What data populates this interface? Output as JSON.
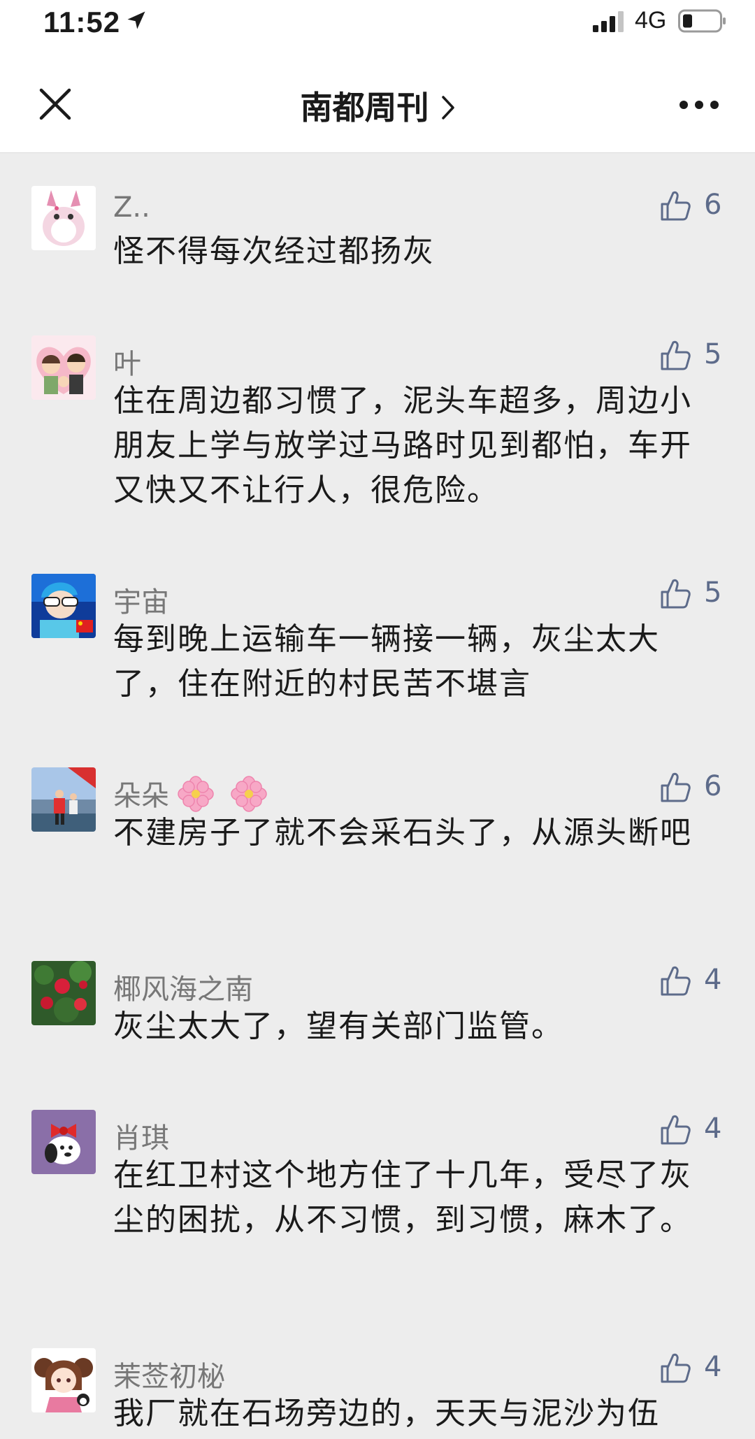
{
  "status": {
    "time": "11:52",
    "network": "4G"
  },
  "nav": {
    "title": "南都周刊"
  },
  "icons": {
    "close": "close-icon",
    "more": "more-icon",
    "like": "thumbs-up-icon"
  },
  "colors": {
    "background": "#ededed",
    "name": "#777777",
    "like": "#5d6b8a"
  },
  "comments": [
    {
      "name": "Z..",
      "likes": "6",
      "text": "怪不得每次经过都扬灰"
    },
    {
      "name": "叶",
      "likes": "5",
      "text": "住在周边都习惯了，泥头车超多，周边小朋友上学与放学过马路时见到都怕，车开又快又不让行人，很危险。"
    },
    {
      "name": "宇宙",
      "likes": "5",
      "text": "每到晚上运输车一辆接一辆，灰尘太大了，住在附近的村民苦不堪言"
    },
    {
      "name": "朵朵",
      "likes": "6",
      "text": "不建房子了就不会采石头了，从源头断吧"
    },
    {
      "name": "椰风海之南",
      "likes": "4",
      "text": "灰尘太大了，望有关部门监管。"
    },
    {
      "name": "肖琪",
      "likes": "4",
      "text": "在红卫村这个地方住了十几年，受尽了灰尘的困扰，从不习惯，到习惯，麻木了。"
    },
    {
      "name": "茉莶初柲",
      "likes": "4",
      "text": "我厂就在石场旁边的，天天与泥沙为伍"
    }
  ]
}
